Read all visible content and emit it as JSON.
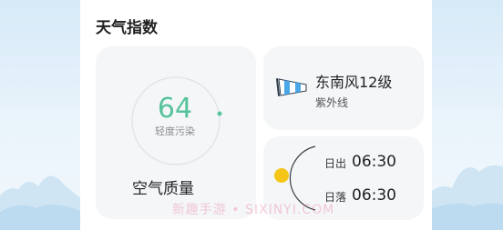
{
  "section": {
    "title": "天气指数"
  },
  "air_quality": {
    "value": "64",
    "level": "轻度污染",
    "title": "空气质量",
    "accent_color": "#58c39b"
  },
  "wind": {
    "icon": "windsock-icon",
    "text": "东南风12级",
    "uv_label": "紫外线"
  },
  "sun": {
    "sunrise_label": "日出",
    "sunrise_time": "06:30",
    "sunset_label": "日落",
    "sunset_time": "06:30",
    "sun_color": "#f5c518"
  },
  "watermark": "新趣手游 • SIXINYI.COM"
}
